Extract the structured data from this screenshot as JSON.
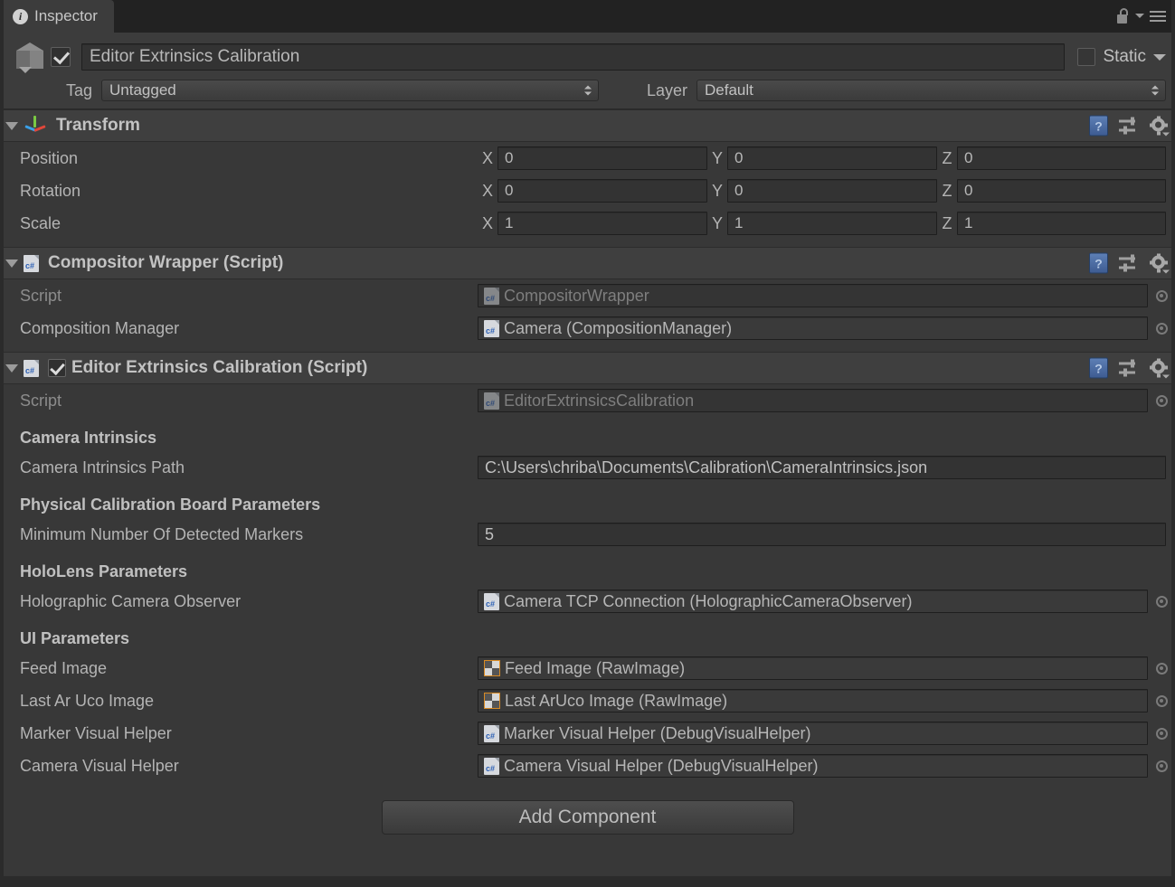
{
  "window": {
    "tab_label": "Inspector",
    "tab_icon": "info-icon",
    "lock_icon": "lock-icon",
    "menu_icon": "hamburger-menu-icon"
  },
  "object_header": {
    "enabled": true,
    "name_value": "Editor Extrinsics Calibration",
    "static_label": "Static",
    "static_checked": false,
    "tag_label": "Tag",
    "tag_value": "Untagged",
    "layer_label": "Layer",
    "layer_value": "Default"
  },
  "components": [
    {
      "title": "Transform",
      "icon": "transform-gizmo-icon",
      "rows": [
        {
          "label": "Position",
          "x": "0",
          "y": "0",
          "z": "0"
        },
        {
          "label": "Rotation",
          "x": "0",
          "y": "0",
          "z": "0"
        },
        {
          "label": "Scale",
          "x": "1",
          "y": "1",
          "z": "1"
        }
      ],
      "axis_labels": {
        "x": "X",
        "y": "Y",
        "z": "Z"
      }
    },
    {
      "title": "Compositor Wrapper (Script)",
      "icon": "csharp-script-icon",
      "script_label": "Script",
      "script_value": "CompositorWrapper",
      "field_label": "Composition Manager",
      "field_value": "Camera (CompositionManager)"
    },
    {
      "title": "Editor Extrinsics Calibration (Script)",
      "icon": "csharp-script-icon",
      "enabled": true,
      "script_label": "Script",
      "script_value": "EditorExtrinsicsCalibration",
      "sections": [
        {
          "heading": "Camera Intrinsics",
          "fields": [
            {
              "label": "Camera Intrinsics Path",
              "value": "C:\\Users\\chriba\\Documents\\Calibration\\CameraIntrinsics.json",
              "kind": "text"
            }
          ]
        },
        {
          "heading": "Physical Calibration Board Parameters",
          "fields": [
            {
              "label": "Minimum Number Of Detected Markers",
              "value": "5",
              "kind": "text"
            }
          ]
        },
        {
          "heading": "HoloLens Parameters",
          "fields": [
            {
              "label": "Holographic Camera Observer",
              "value": "Camera TCP Connection (HolographicCameraObserver)",
              "kind": "object",
              "icon": "csharp-script-icon"
            }
          ]
        },
        {
          "heading": "UI Parameters",
          "fields": [
            {
              "label": "Feed Image",
              "value": "Feed Image (RawImage)",
              "kind": "object",
              "icon": "raw-image-icon"
            },
            {
              "label": "Last Ar Uco Image",
              "value": "Last ArUco Image (RawImage)",
              "kind": "object",
              "icon": "raw-image-icon"
            },
            {
              "label": "Marker Visual Helper",
              "value": "Marker Visual Helper (DebugVisualHelper)",
              "kind": "object",
              "icon": "csharp-script-icon"
            },
            {
              "label": "Camera Visual Helper",
              "value": "Camera Visual Helper (DebugVisualHelper)",
              "kind": "object",
              "icon": "csharp-script-icon"
            }
          ]
        }
      ]
    }
  ],
  "header_icons": {
    "help": "?",
    "preset": "preset-icon",
    "settings": "gear-icon"
  },
  "footer": {
    "add_component_label": "Add Component"
  },
  "colors": {
    "panel_bg": "#383838",
    "header_bg": "#3f3f3f",
    "tabbar_bg": "#222222",
    "field_bg": "#333333",
    "text": "#b4b4b4",
    "axis_x": "#e0473a",
    "axis_y": "#7ac943",
    "axis_z": "#3aa0e8",
    "raw_image_border": "#d98b25",
    "help_blue": "#3e5c92"
  }
}
